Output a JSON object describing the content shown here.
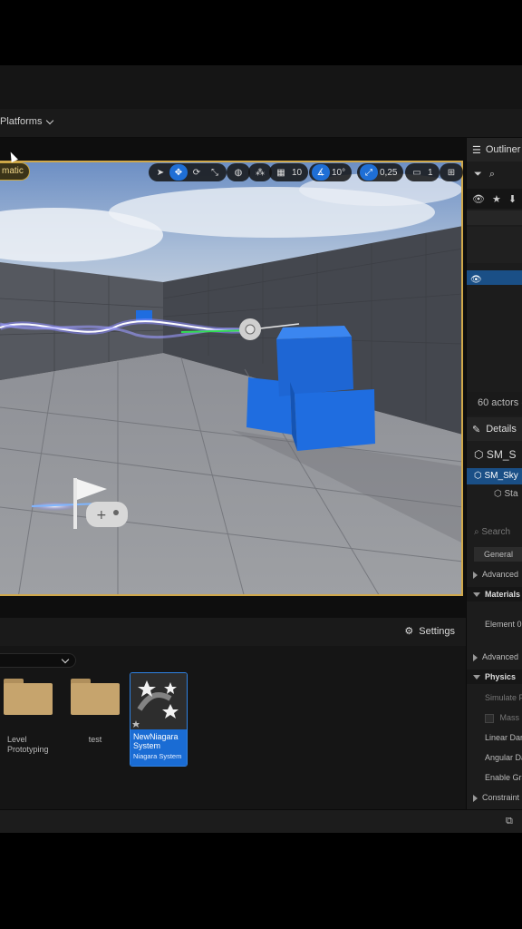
{
  "toolbar": {
    "platforms_label": "Platforms"
  },
  "viewport": {
    "view_mode_label": "matic",
    "grid_snap_value": "10",
    "rotation_snap_value": "10°",
    "scale_snap_value": "0,25",
    "camera_speed_value": "1"
  },
  "outliner": {
    "title": "Outliner",
    "actor_count": "60 actors ("
  },
  "details": {
    "title": "Details",
    "actor_name": "SM_S",
    "component_selected": "SM_Sky",
    "component_child": "Sta",
    "search_placeholder": "Search",
    "tab_general": "General",
    "rows": {
      "advanced_1": "Advanced",
      "materials": "Materials",
      "element_0": "Element 0",
      "advanced_2": "Advanced",
      "physics": "Physics",
      "simulate": "Simulate P",
      "mass": "Mass",
      "linear_damping": "Linear Dam",
      "angular_damping": "Angular Da",
      "enable_gravity": "Enable Gra",
      "constraints": "Constraint"
    }
  },
  "content_browser": {
    "settings_label": "Settings",
    "assets": [
      {
        "name": "Level Prototyping"
      },
      {
        "name": "test"
      }
    ],
    "niagara": {
      "name": "NewNiagara System",
      "type": "Niagara System"
    }
  },
  "colors": {
    "accent": "#1f6fd6",
    "viewport_border": "#d0a84a",
    "cube": "#1f6de0"
  }
}
